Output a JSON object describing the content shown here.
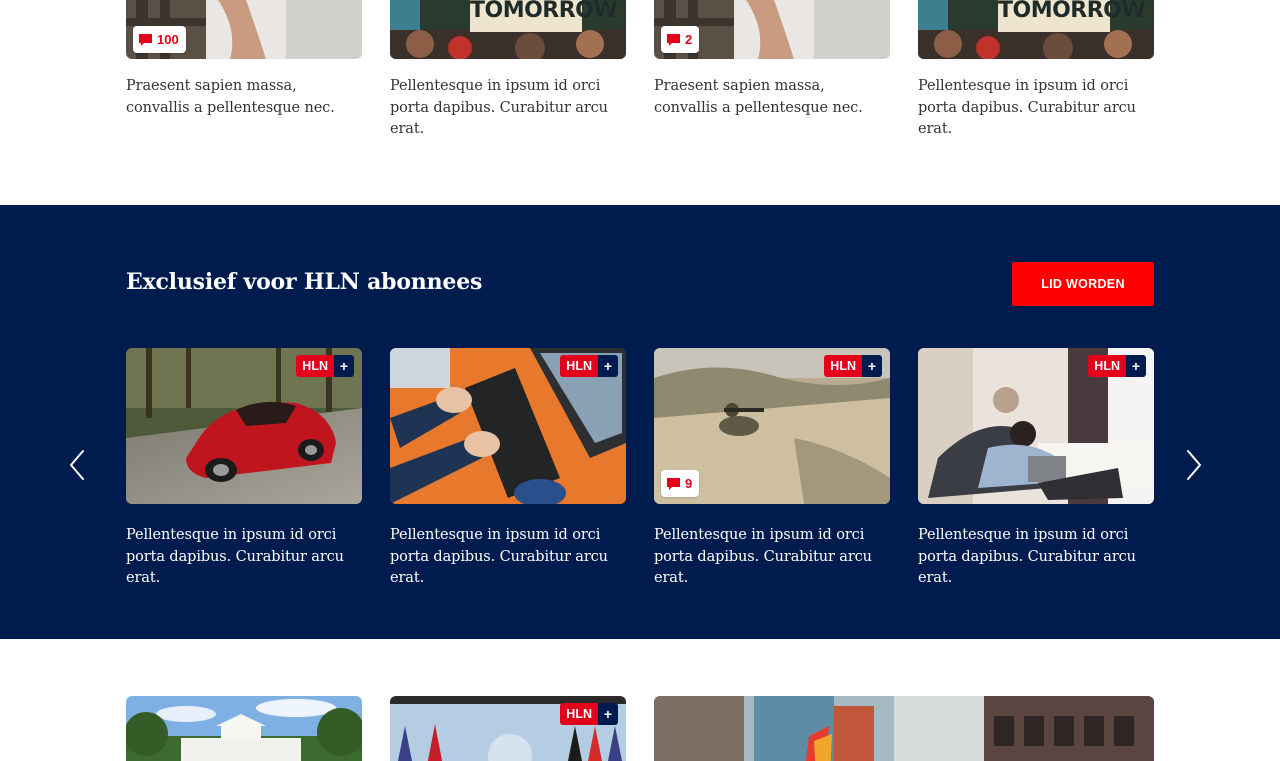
{
  "colors": {
    "navy": "#001b4d",
    "red": "#e4001b",
    "cta": "#ff0000"
  },
  "top_row": [
    {
      "title": "Praesent sapien massa, convallis a pellentesque nec.",
      "comments": "100",
      "image": "protester-in-plaid-shirt-photo"
    },
    {
      "title": "Pellentesque in ipsum id orci porta dapibus. Curabitur arcu erat.",
      "sign_text": "TOMORROW",
      "image": "climate-protest-crowd-photo"
    },
    {
      "title": "Praesent sapien massa, convallis a pellentesque nec.",
      "comments": "2",
      "image": "protester-in-plaid-shirt-photo"
    },
    {
      "title": "Pellentesque in ipsum id orci porta dapibus. Curabitur arcu erat.",
      "sign_text": "TOMORROW",
      "image": "climate-protest-crowd-photo"
    }
  ],
  "premium": {
    "title": "Exclusief voor HLN abonnees",
    "cta_label": "LID WORDEN",
    "badge_label": "HLN",
    "badge_plus": "+",
    "prev_icon": "chevron-left-icon",
    "next_icon": "chevron-right-icon",
    "cards": [
      {
        "title": "Pellentesque in ipsum id orci porta dapibus. Curabitur arcu erat.",
        "image": "red-sports-car-photo"
      },
      {
        "title": "Pellentesque in ipsum id orci porta dapibus. Curabitur arcu erat.",
        "image": "hands-on-keyboard-photo"
      },
      {
        "title": "Pellentesque in ipsum id orci porta dapibus. Curabitur arcu erat.",
        "comments": "9",
        "image": "soldier-in-desert-photo"
      },
      {
        "title": "Pellentesque in ipsum id orci porta dapibus. Curabitur arcu erat.",
        "image": "couple-on-sofa-with-laptop-photo"
      }
    ]
  },
  "bottom_row": {
    "badge_label": "HLN",
    "badge_plus": "+",
    "images": [
      "white-house-photo",
      "flags-on-stage-photo",
      "rainbow-flags-street-photo"
    ]
  }
}
